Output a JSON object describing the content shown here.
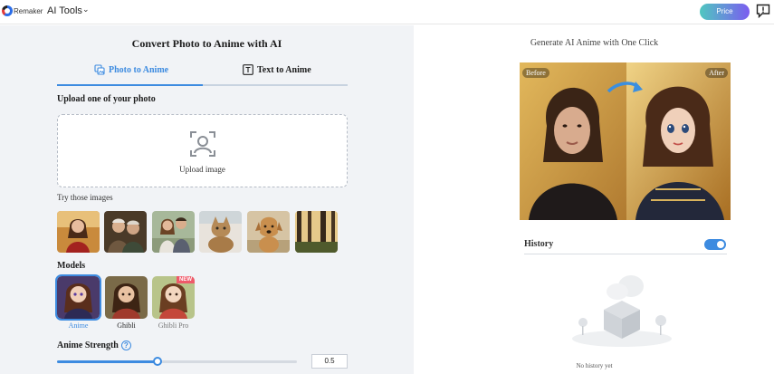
{
  "header": {
    "brand": "Remaker",
    "menu_label": "AI Tools",
    "price_label": "Price"
  },
  "left": {
    "title": "Convert Photo to Anime with AI",
    "tabs": [
      {
        "label": "Photo to Anime",
        "active": true
      },
      {
        "label": "Text to Anime",
        "active": false
      }
    ],
    "upload_heading": "Upload one of your photo",
    "upload_label": "Upload image",
    "try_label": "Try those images",
    "sample_images": [
      "woman in red",
      "elderly couple",
      "young couple",
      "cat",
      "dog",
      "forest"
    ],
    "models_heading": "Models",
    "models": [
      {
        "label": "Anime",
        "selected": true,
        "badge": ""
      },
      {
        "label": "Ghibli",
        "selected": false,
        "badge": ""
      },
      {
        "label": "Ghibli Pro",
        "selected": false,
        "badge": "NEW"
      }
    ],
    "strength_heading": "Anime Strength",
    "strength_help": "?",
    "strength_value": "0.5",
    "strength_level": 0.42
  },
  "right": {
    "title": "Generate AI Anime with One Click",
    "before_tag": "Before",
    "after_tag": "After",
    "history_title": "History",
    "history_enabled": true,
    "empty_text": "No history yet"
  },
  "colors": {
    "accent": "#3d8be0",
    "new_badge": "#ef5a6a",
    "left_bg": "#f1f3f6"
  }
}
